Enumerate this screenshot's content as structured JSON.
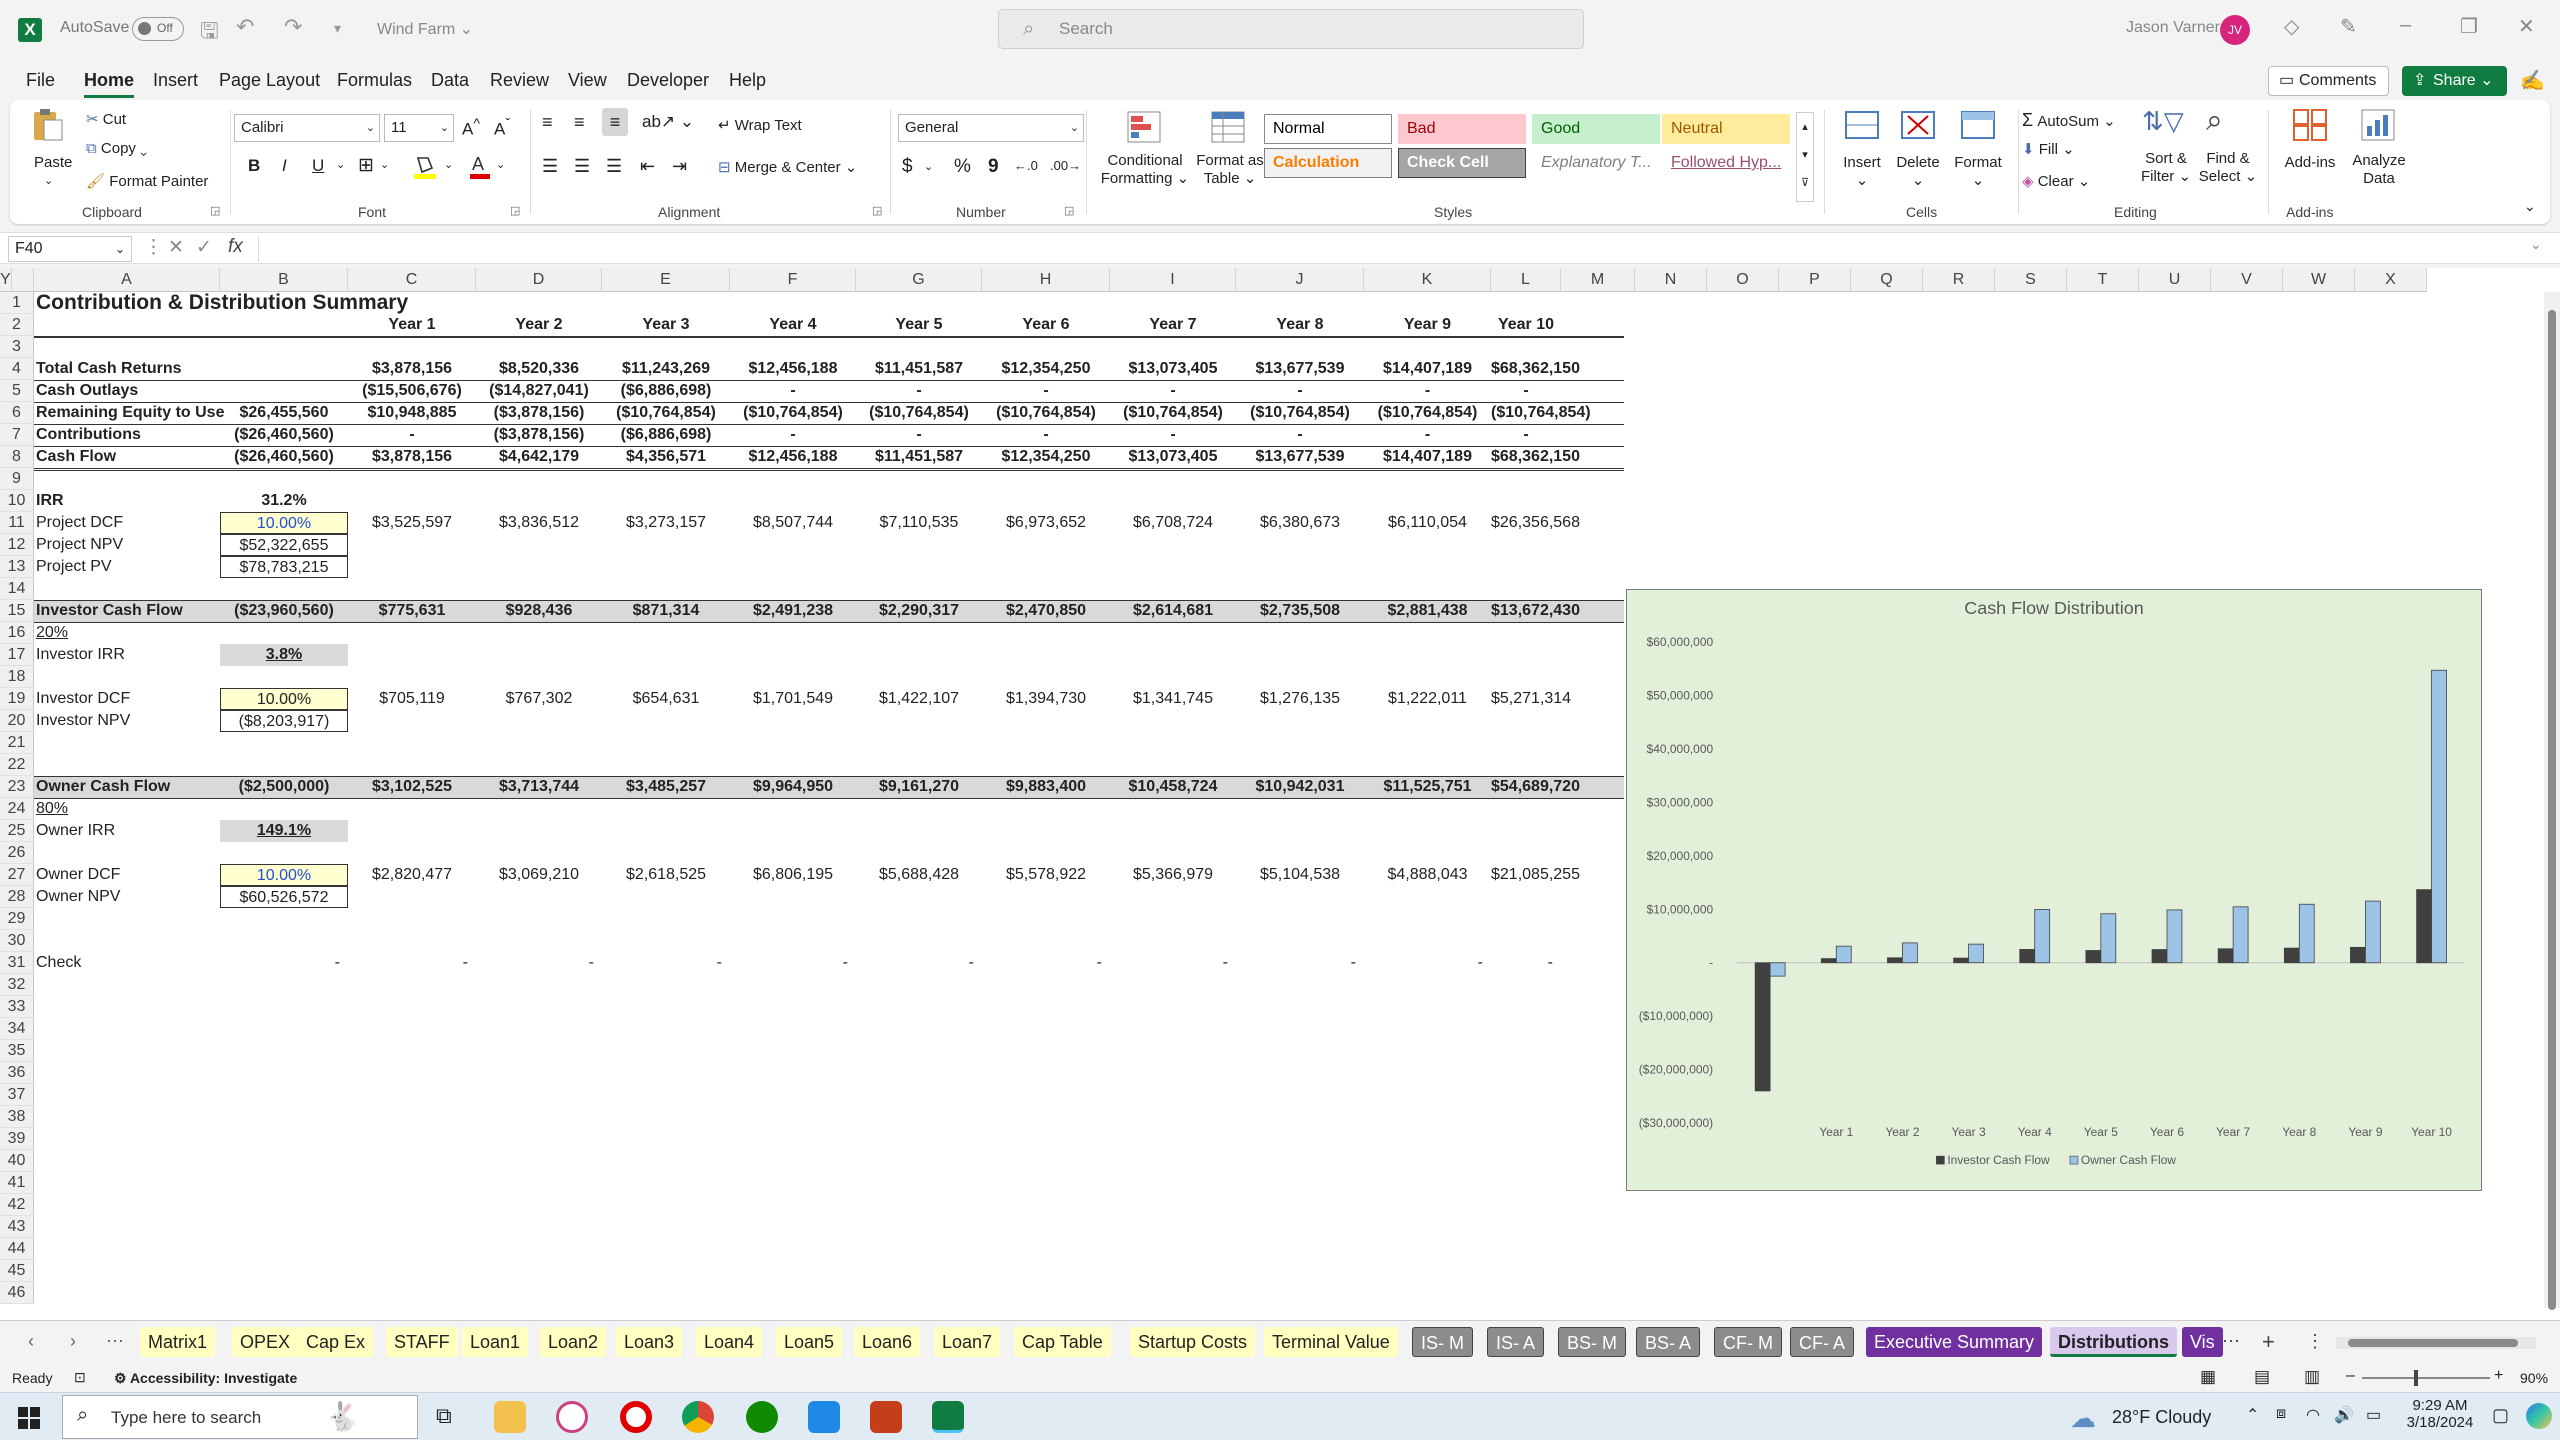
{
  "window": {
    "autosave_label": "AutoSave",
    "autosave_state": "Off",
    "doc_title": "Wind Farm",
    "search_placeholder": "Search",
    "user_name": "Jason Varner",
    "user_initials": "JV"
  },
  "menu": [
    "File",
    "Home",
    "Insert",
    "Page Layout",
    "Formulas",
    "Data",
    "Review",
    "View",
    "Developer",
    "Help"
  ],
  "top_buttons": {
    "comments": "Comments",
    "share": "Share"
  },
  "ribbon": {
    "clipboard": {
      "paste": "Paste",
      "cut": "Cut",
      "copy": "Copy",
      "format_painter": "Format Painter",
      "label": "Clipboard"
    },
    "font": {
      "name": "Calibri",
      "size": "11",
      "label": "Font",
      "bold": "B",
      "italic": "I",
      "underline": "U"
    },
    "alignment": {
      "wrap": "Wrap Text",
      "merge": "Merge & Center",
      "label": "Alignment"
    },
    "number": {
      "format": "General",
      "label": "Number",
      "currency": "$",
      "percent": "%",
      "comma": "9"
    },
    "styles": {
      "cond_line1": "Conditional",
      "cond_line2": "Formatting",
      "fmt_table_line1": "Format as",
      "fmt_table_line2": "Table",
      "label": "Styles",
      "cells": [
        {
          "name": "Normal",
          "bg": "#ffffff",
          "fg": "#000000",
          "border": "#8a8a8a"
        },
        {
          "name": "Bad",
          "bg": "#ffc7ce",
          "fg": "#9c0006",
          "border": "#ffc7ce"
        },
        {
          "name": "Good",
          "bg": "#c6efce",
          "fg": "#006100",
          "border": "#c6efce"
        },
        {
          "name": "Neutral",
          "bg": "#ffeb9c",
          "fg": "#9c5700",
          "border": "#ffeb9c"
        },
        {
          "name": "Calculation",
          "bg": "#f2f2f2",
          "fg": "#fa7d00",
          "border": "#7f7f7f"
        },
        {
          "name": "Check Cell",
          "bg": "#a5a5a5",
          "fg": "#ffffff",
          "border": "#3f3f3f"
        },
        {
          "name": "Explanatory T...",
          "bg": "#ffffff",
          "fg": "#7f7f7f",
          "border": "#ffffff"
        },
        {
          "name": "Followed Hyp...",
          "bg": "#ffffff",
          "fg": "#954f72",
          "border": "#ffffff"
        }
      ]
    },
    "cells": {
      "insert": "Insert",
      "delete": "Delete",
      "format": "Format",
      "label": "Cells"
    },
    "editing": {
      "autosum": "AutoSum",
      "fill": "Fill",
      "clear": "Clear",
      "sort_line1": "Sort &",
      "sort_line2": "Filter",
      "find_line1": "Find &",
      "find_line2": "Select",
      "label": "Editing"
    },
    "addins": {
      "addins": "Add-ins",
      "analyze_line1": "Analyze",
      "analyze_line2": "Data",
      "label": "Add-ins"
    }
  },
  "formula_bar": {
    "name_box": "F40",
    "fx": "fx",
    "content": ""
  },
  "columns": [
    "A",
    "B",
    "C",
    "D",
    "E",
    "F",
    "G",
    "H",
    "I",
    "J",
    "K",
    "L",
    "M",
    "N",
    "O",
    "P",
    "Q",
    "R",
    "S",
    "T",
    "U",
    "V",
    "W",
    "X",
    "Y"
  ],
  "rows": [
    "1",
    "2",
    "3",
    "4",
    "5",
    "6",
    "7",
    "8",
    "9",
    "10",
    "11",
    "12",
    "13",
    "14",
    "15",
    "16",
    "17",
    "18",
    "19",
    "20",
    "21",
    "22",
    "23",
    "24",
    "25",
    "26",
    "27",
    "28",
    "29",
    "30",
    "31",
    "32",
    "33",
    "34",
    "35",
    "36",
    "37",
    "38",
    "39",
    "40",
    "41",
    "42",
    "43",
    "44",
    "45",
    "46"
  ],
  "sheet": {
    "title": "Contribution & Distribution Summary",
    "years": [
      "Year 1",
      "Year 2",
      "Year 3",
      "Year 4",
      "Year 5",
      "Year 6",
      "Year 7",
      "Year 8",
      "Year 9",
      "Year 10"
    ],
    "table_rows": [
      {
        "row": 4,
        "label": "Total Cash Returns",
        "b": "",
        "vals": [
          "$3,878,156",
          "$8,520,336",
          "$11,243,269",
          "$12,456,188",
          "$11,451,587",
          "$12,354,250",
          "$13,073,405",
          "$13,677,539",
          "$14,407,189",
          "$68,362,150"
        ]
      },
      {
        "row": 5,
        "label": "Cash Outlays",
        "b": "",
        "vals": [
          "($15,506,676)",
          "($14,827,041)",
          "($6,886,698)",
          "-",
          "-",
          "-",
          "-",
          "-",
          "-",
          "-"
        ]
      },
      {
        "row": 6,
        "label": "Remaining Equity to Use",
        "b": "$26,455,560",
        "vals": [
          "$10,948,885",
          "($3,878,156)",
          "($10,764,854)",
          "($10,764,854)",
          "($10,764,854)",
          "($10,764,854)",
          "($10,764,854)",
          "($10,764,854)",
          "($10,764,854)",
          "($10,764,854)"
        ]
      },
      {
        "row": 7,
        "label": "Contributions",
        "b": "($26,460,560)",
        "vals": [
          "-",
          "($3,878,156)",
          "($6,886,698)",
          "-",
          "-",
          "-",
          "-",
          "-",
          "-",
          "-"
        ]
      },
      {
        "row": 8,
        "label": "Cash Flow",
        "b": "($26,460,560)",
        "vals": [
          "$3,878,156",
          "$4,642,179",
          "$4,356,571",
          "$12,456,188",
          "$11,451,587",
          "$12,354,250",
          "$13,073,405",
          "$13,677,539",
          "$14,407,189",
          "$68,362,150"
        ]
      }
    ],
    "irr": {
      "label": "IRR",
      "value": "31.2%"
    },
    "project_dcf": {
      "label": "Project DCF",
      "rate": "10.00%",
      "vals": [
        "$3,525,597",
        "$3,836,512",
        "$3,273,157",
        "$8,507,744",
        "$7,110,535",
        "$6,973,652",
        "$6,708,724",
        "$6,380,673",
        "$6,110,054",
        "$26,356,568"
      ]
    },
    "project_npv": {
      "label": "Project NPV",
      "value": "$52,322,655"
    },
    "project_pv": {
      "label": "Project PV",
      "value": "$78,783,215"
    },
    "investor_cf": {
      "label": "Investor Cash Flow",
      "b": "($23,960,560)",
      "vals": [
        "$775,631",
        "$928,436",
        "$871,314",
        "$2,491,238",
        "$2,290,317",
        "$2,470,850",
        "$2,614,681",
        "$2,735,508",
        "$2,881,438",
        "$13,672,430"
      ]
    },
    "investor_pct": "20%",
    "investor_irr": {
      "label": "Investor IRR",
      "value": "3.8%"
    },
    "investor_dcf": {
      "label": "Investor DCF",
      "rate": "10.00%",
      "vals": [
        "$705,119",
        "$767,302",
        "$654,631",
        "$1,701,549",
        "$1,422,107",
        "$1,394,730",
        "$1,341,745",
        "$1,276,135",
        "$1,222,011",
        "$5,271,314"
      ]
    },
    "investor_npv": {
      "label": "Investor NPV",
      "value": "($8,203,917)"
    },
    "owner_cf": {
      "label": "Owner Cash Flow",
      "b": "($2,500,000)",
      "vals": [
        "$3,102,525",
        "$3,713,744",
        "$3,485,257",
        "$9,964,950",
        "$9,161,270",
        "$9,883,400",
        "$10,458,724",
        "$10,942,031",
        "$11,525,751",
        "$54,689,720"
      ]
    },
    "owner_pct": "80%",
    "owner_irr": {
      "label": "Owner IRR",
      "value": "149.1%"
    },
    "owner_dcf": {
      "label": "Owner DCF",
      "rate": "10.00%",
      "vals": [
        "$2,820,477",
        "$3,069,210",
        "$2,618,525",
        "$6,806,195",
        "$5,688,428",
        "$5,578,922",
        "$5,366,979",
        "$5,104,538",
        "$4,888,043",
        "$21,085,255"
      ]
    },
    "owner_npv": {
      "label": "Owner NPV",
      "value": "$60,526,572"
    },
    "check": {
      "label": "Check",
      "vals": [
        "-",
        "-",
        "-",
        "-",
        "-",
        "-",
        "-",
        "-",
        "-",
        "-",
        "-"
      ]
    }
  },
  "chart_data": {
    "type": "bar",
    "title": "Cash Flow Distribution",
    "categories": [
      "",
      "Year 1",
      "Year 2",
      "Year 3",
      "Year 4",
      "Year 5",
      "Year 6",
      "Year 7",
      "Year 8",
      "Year 9",
      "Year 10"
    ],
    "series": [
      {
        "name": "Investor Cash Flow",
        "color": "#404040",
        "values": [
          -23960560,
          775631,
          928436,
          871314,
          2491238,
          2290317,
          2470850,
          2614681,
          2735508,
          2881438,
          13672430
        ]
      },
      {
        "name": "Owner Cash Flow",
        "color": "#9dc3e6",
        "values": [
          -2500000,
          3102525,
          3713744,
          3485257,
          9964950,
          9161270,
          9883400,
          10458724,
          10942031,
          11525751,
          54689720
        ]
      }
    ],
    "ylim": [
      -30000000,
      60000000
    ],
    "yticks": [
      "$60,000,000",
      "$50,000,000",
      "$40,000,000",
      "$30,000,000",
      "$20,000,000",
      "$10,000,000",
      "-",
      "($10,000,000)",
      "($20,000,000)",
      "($30,000,000)"
    ],
    "legend": "bottom",
    "grid": false
  },
  "tabs": [
    {
      "name": "Matrix1",
      "bg": "#ffffc0",
      "fg": "#222222"
    },
    {
      "name": "OPEX",
      "bg": "#ffffc0",
      "fg": "#222222"
    },
    {
      "name": "Cap Ex",
      "bg": "#ffffc0",
      "fg": "#222222"
    },
    {
      "name": "STAFF",
      "bg": "#ffffc0",
      "fg": "#222222"
    },
    {
      "name": "Loan1",
      "bg": "#ffffc0",
      "fg": "#222222"
    },
    {
      "name": "Loan2",
      "bg": "#ffffc0",
      "fg": "#222222"
    },
    {
      "name": "Loan3",
      "bg": "#ffffc0",
      "fg": "#222222"
    },
    {
      "name": "Loan4",
      "bg": "#ffffc0",
      "fg": "#222222"
    },
    {
      "name": "Loan5",
      "bg": "#ffffc0",
      "fg": "#222222"
    },
    {
      "name": "Loan6",
      "bg": "#ffffc0",
      "fg": "#222222"
    },
    {
      "name": "Loan7",
      "bg": "#ffffc0",
      "fg": "#222222"
    },
    {
      "name": "Cap Table",
      "bg": "#ffffc0",
      "fg": "#222222"
    },
    {
      "name": "Startup Costs",
      "bg": "#ffffc0",
      "fg": "#222222"
    },
    {
      "name": "Terminal Value",
      "bg": "#ffffc0",
      "fg": "#222222"
    },
    {
      "name": "IS- M",
      "bg": "#8c8c8c",
      "fg": "#ffffff"
    },
    {
      "name": "IS- A",
      "bg": "#8c8c8c",
      "fg": "#ffffff"
    },
    {
      "name": "BS- M",
      "bg": "#8c8c8c",
      "fg": "#ffffff"
    },
    {
      "name": "BS- A",
      "bg": "#8c8c8c",
      "fg": "#ffffff"
    },
    {
      "name": "CF- M",
      "bg": "#8c8c8c",
      "fg": "#ffffff"
    },
    {
      "name": "CF- A",
      "bg": "#8c8c8c",
      "fg": "#ffffff"
    },
    {
      "name": "Executive Summary",
      "bg": "#7030a0",
      "fg": "#ffffff"
    },
    {
      "name": "Distributions",
      "bg": "#d9c8ee",
      "fg": "#222222"
    },
    {
      "name": "Vis",
      "bg": "#7030a0",
      "fg": "#ffffff"
    }
  ],
  "status": {
    "ready": "Ready",
    "accessibility": "Accessibility: Investigate",
    "zoom": "90%"
  },
  "taskbar": {
    "search_placeholder": "Type here to search",
    "weather": "28°F  Cloudy",
    "time": "9:29 AM",
    "date": "3/18/2024"
  }
}
